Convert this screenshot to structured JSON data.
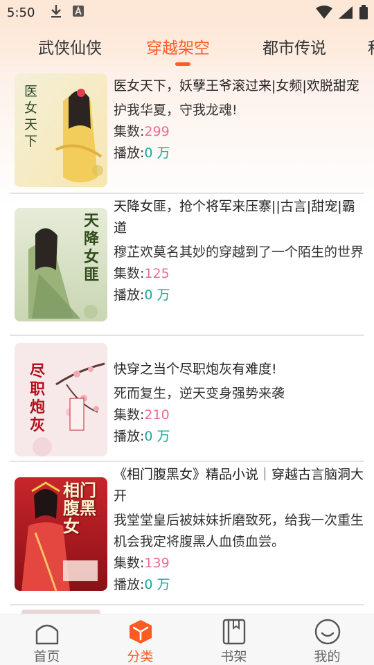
{
  "status_bar": {
    "time": "5:50",
    "left_icons": [
      "download-icon",
      "a-badge-icon"
    ],
    "right_icons": [
      "wifi-icon",
      "signal-icon",
      "battery-icon"
    ]
  },
  "tabs": [
    {
      "label": "武侠仙侠",
      "active": false
    },
    {
      "label": "穿越架空",
      "active": true
    },
    {
      "label": "都市传说",
      "active": false
    },
    {
      "label": "科",
      "active": false
    }
  ],
  "colors": {
    "accent": "#ff5a1f",
    "episode": "#f06a93",
    "plays": "#1ea39a"
  },
  "items": [
    {
      "title": "医女天下，妖孽王爷滚过来|女频|欢脱甜宠",
      "desc": "护我华夏，守我龙魂!",
      "episode_label": "集数:",
      "episodes": "299",
      "plays_label": "播放:",
      "plays": "0 万",
      "cover_text": "医女天下"
    },
    {
      "title": "天降女匪，抢个将军来压寨||古言|甜宠|霸道",
      "desc": "穆芷欢莫名其妙的穿越到了一个陌生的世界",
      "episode_label": "集数:",
      "episodes": "125",
      "plays_label": "播放:",
      "plays": "0 万",
      "cover_text": "天降女匪"
    },
    {
      "title": "快穿之当个尽职炮灰有难度!",
      "desc": "死而复生，逆天变身强势来袭",
      "episode_label": "集数:",
      "episodes": "210",
      "plays_label": "播放:",
      "plays": "0 万",
      "cover_text": "尽职炮灰"
    },
    {
      "title": "《相门腹黑女》精品小说｜穿越古言脑洞大开",
      "desc": "我堂堂皇后被妹妹折磨致死，给我一次重生机会我定将腹黑人血债血尝。",
      "episode_label": "集数:",
      "episodes": "139",
      "plays_label": "播放:",
      "plays": "0 万",
      "cover_text": "相门腹黑女"
    }
  ],
  "bottom_nav": [
    {
      "label": "首页",
      "icon": "home-icon",
      "active": false
    },
    {
      "label": "分类",
      "icon": "category-cube-icon",
      "active": true
    },
    {
      "label": "书架",
      "icon": "bookshelf-icon",
      "active": false
    },
    {
      "label": "我的",
      "icon": "profile-smile-icon",
      "active": false
    }
  ]
}
